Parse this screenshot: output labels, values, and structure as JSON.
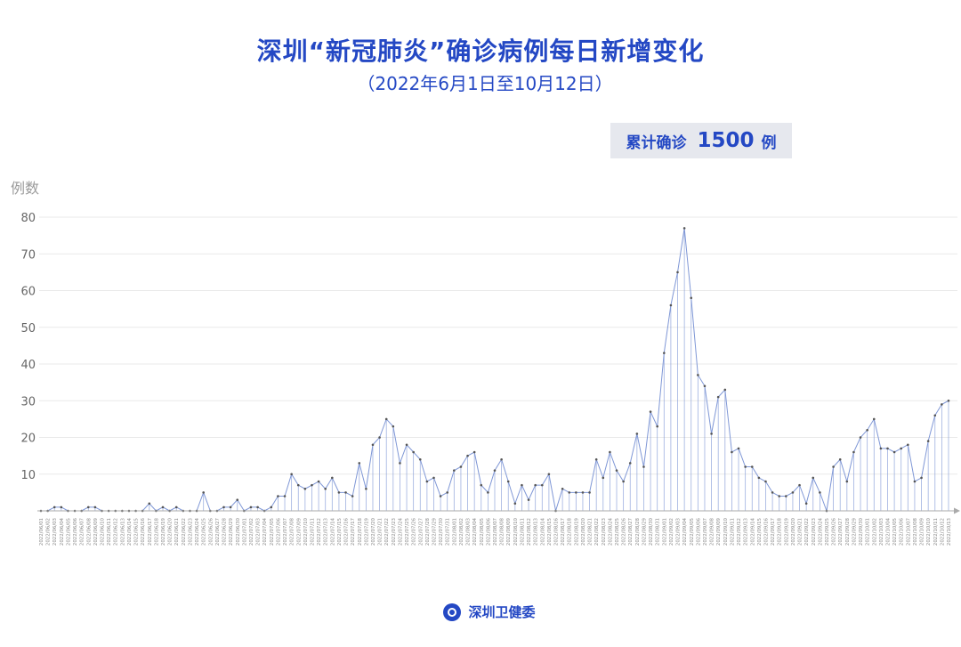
{
  "header": {
    "title": "深圳“新冠肺炎”确诊病例每日新增变化",
    "subtitle": "（2022年6月1日至10月12日）"
  },
  "total": {
    "label": "累计确诊",
    "value": "1500",
    "unit": "例"
  },
  "footer": {
    "org": "深圳卫健委",
    "logo_icon": "health-commission-logo-icon"
  },
  "colors": {
    "title": "#2448c4",
    "line": "#7f97d6",
    "marker": "#555555",
    "grid": "#e9e9e9",
    "axis": "#aaaaaa"
  },
  "chart_data": {
    "type": "line",
    "title": "深圳“新冠肺炎”确诊病例每日新增变化",
    "subtitle": "（2022年6月1日至10月12日）",
    "ylabel": "例数",
    "xlabel": "",
    "ylim": [
      0,
      80
    ],
    "yticks": [
      10,
      20,
      30,
      40,
      50,
      60,
      70,
      80
    ],
    "grid": true,
    "x_start": "2022-06-01",
    "x_end": "2022-10-12",
    "values": [
      0,
      0,
      1,
      1,
      0,
      0,
      0,
      1,
      1,
      0,
      0,
      0,
      0,
      0,
      0,
      0,
      2,
      0,
      1,
      0,
      1,
      0,
      0,
      0,
      5,
      0,
      0,
      1,
      1,
      3,
      0,
      1,
      1,
      0,
      1,
      4,
      4,
      10,
      7,
      6,
      7,
      8,
      6,
      9,
      5,
      5,
      4,
      13,
      6,
      18,
      20,
      25,
      23,
      13,
      18,
      16,
      14,
      8,
      9,
      4,
      5,
      11,
      12,
      15,
      16,
      7,
      5,
      11,
      14,
      8,
      2,
      7,
      3,
      7,
      7,
      10,
      0,
      6,
      5,
      5,
      5,
      5,
      14,
      9,
      16,
      11,
      8,
      13,
      21,
      12,
      27,
      23,
      43,
      56,
      65,
      77,
      58,
      37,
      34,
      21,
      31,
      33,
      16,
      17,
      12,
      12,
      9,
      8,
      5,
      4,
      4,
      5,
      7,
      2,
      9,
      5,
      0,
      12,
      14,
      8,
      16,
      20,
      22,
      25,
      17,
      17,
      16,
      17,
      18,
      8,
      9,
      19,
      26,
      29,
      30
    ]
  }
}
